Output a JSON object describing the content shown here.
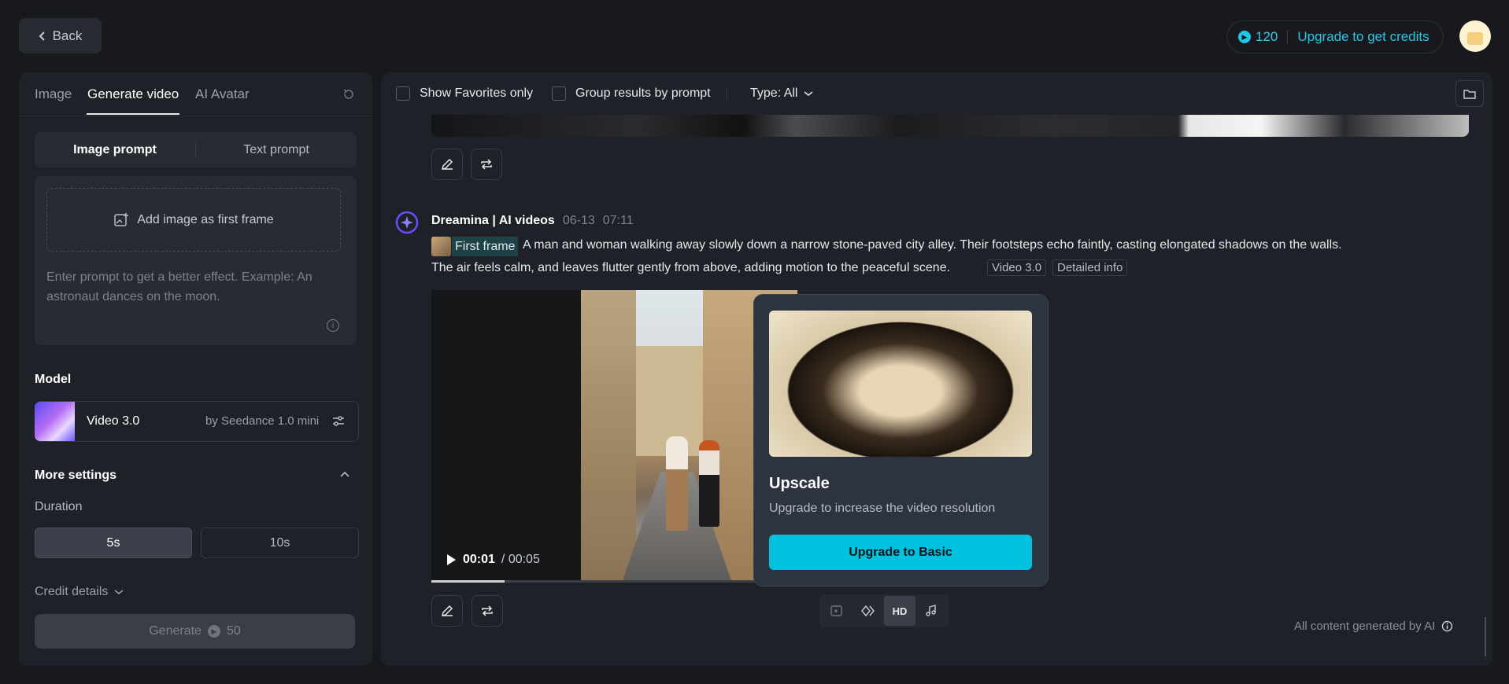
{
  "header": {
    "back_label": "Back",
    "credits_count": "120",
    "upgrade_link": "Upgrade to get credits"
  },
  "left": {
    "tabs": [
      {
        "label": "Image",
        "active": false
      },
      {
        "label": "Generate video",
        "active": true
      },
      {
        "label": "AI Avatar",
        "active": false
      }
    ],
    "prompt_modes": [
      {
        "label": "Image prompt",
        "active": true
      },
      {
        "label": "Text prompt",
        "active": false
      }
    ],
    "add_image_label": "Add image as first frame",
    "prompt_placeholder": "Enter prompt to get a better effect. Example: An astronaut dances on the moon.",
    "model_heading": "Model",
    "model": {
      "name": "Video 3.0",
      "by": "by Seedance 1.0 mini"
    },
    "more_settings_label": "More settings",
    "duration_label": "Duration",
    "durations": [
      {
        "label": "5s",
        "selected": true
      },
      {
        "label": "10s",
        "selected": false
      }
    ],
    "credit_details_label": "Credit details",
    "generate_label": "Generate",
    "generate_cost": "50"
  },
  "filters": {
    "favorites_label": "Show Favorites only",
    "group_label": "Group results by prompt",
    "type_label": "Type: All"
  },
  "result": {
    "author": "Dreamina | AI videos",
    "date": "06-13",
    "time": "07:11",
    "first_frame_tag": "First frame",
    "prompt_line1": "A man and woman walking away slowly down a narrow stone-paved city alley. Their footsteps echo faintly, casting elongated shadows on the walls.",
    "prompt_line2": "The air feels calm, and leaves flutter gently from above, adding motion to the peaceful scene.",
    "model_tag": "Video 3.0",
    "detail_tag": "Detailed info",
    "current_time": "00:01",
    "duration": "/ 00:05",
    "progress": 0.2
  },
  "popover": {
    "title": "Upscale",
    "description": "Upgrade to increase the video resolution",
    "button": "Upgrade to Basic"
  },
  "toolbar": {
    "hd_label": "HD"
  },
  "footer_note": "All content generated by AI",
  "colors": {
    "accent": "#00c2df",
    "brand": "#6b4cff"
  }
}
